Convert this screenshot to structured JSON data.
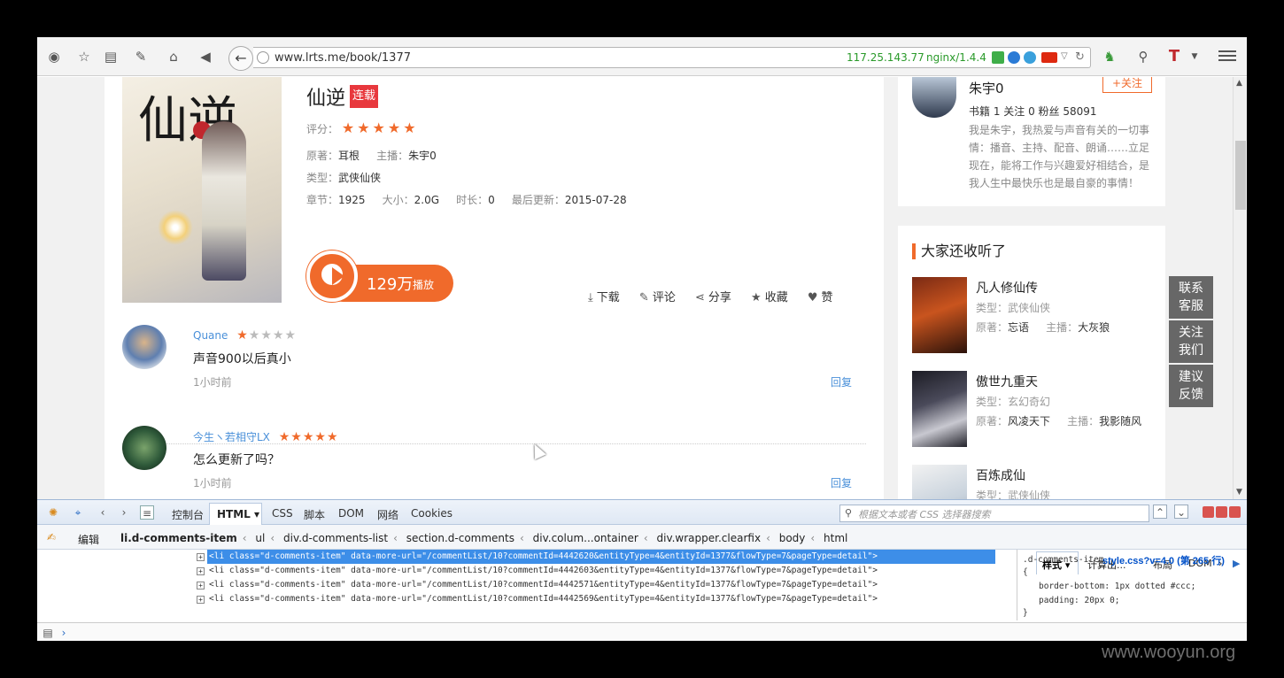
{
  "browser": {
    "url": "www.lrts.me/book/1377",
    "ip": "117.25.143.77",
    "server": "nginx/1.4.4"
  },
  "book": {
    "title": "仙逆",
    "status_badge": "连载",
    "rating_label": "评分：",
    "rating_stars": "★★★★★",
    "author_label": "原著：",
    "author": "耳根",
    "host_label": "主播：",
    "host": "朱宇0",
    "category_label": "类型：",
    "category": "武侠仙侠",
    "chapters_label": "章节：",
    "chapters": "1925",
    "size_label": "大小：",
    "size": "2.0G",
    "duration_label": "时长：",
    "duration": "0",
    "updated_label": "最后更新：",
    "updated": "2015-07-28",
    "play_count": "129万",
    "play_label": "播放",
    "cover_text": "仙逆"
  },
  "actions": {
    "download": "下载",
    "comment": "评论",
    "share": "分享",
    "favorite": "收藏",
    "like": "赞"
  },
  "comments": [
    {
      "user": "Quane",
      "rating": 1,
      "text": "声音900以后真小",
      "time": "1小时前",
      "reply": "回复"
    },
    {
      "user": "今生ヽ若相守LX",
      "rating": 5,
      "text": "怎么更新了吗？",
      "time": "1小时前",
      "reply": "回复"
    }
  ],
  "author_card": {
    "name": "朱宇0",
    "follow": "+关注",
    "stats": "书籍 1  关注 0  粉丝 58091",
    "bio": "我是朱宇，我热爱与声音有关的一切事情：播音、主持、配音、朗诵……立足现在，能将工作与兴趣爱好相结合，是我人生中最快乐也是最自豪的事情！"
  },
  "recommend": {
    "title": "大家还收听了",
    "type_label": "类型：",
    "author_label": "原著：",
    "host_label": "主播：",
    "items": [
      {
        "name": "凡人修仙传",
        "type": "武侠仙侠",
        "author": "忘语",
        "host": "大灰狼"
      },
      {
        "name": "傲世九重天",
        "type": "玄幻奇幻",
        "author": "风凌天下",
        "host": "我影随风"
      },
      {
        "name": "百炼成仙",
        "type": "武侠仙侠"
      }
    ]
  },
  "float_buttons": [
    "联系客服",
    "关注我们",
    "建议反馈"
  ],
  "devtools": {
    "tabs": [
      "控制台",
      "HTML",
      "CSS",
      "脚本",
      "DOM",
      "网络",
      "Cookies"
    ],
    "search_placeholder": "根据文本或者 CSS 选择器搜索",
    "edit": "编辑",
    "breadcrumb": [
      "li.d-comments-item",
      "ul",
      "div.d-comments-list",
      "section.d-comments",
      "div.colum...ontainer",
      "div.wrapper.clearfix",
      "body",
      "html"
    ],
    "side_tabs": [
      "样式",
      "计算出...",
      "布局",
      "DOM"
    ],
    "source_lines": [
      "<li class=\"d-comments-item\" data-more-url=\"/commentList/10?commentId=4442620&entityType=4&entityId=1377&flowType=7&pageType=detail\">",
      "<li class=\"d-comments-item\" data-more-url=\"/commentList/10?commentId=4442603&entityType=4&entityId=1377&flowType=7&pageType=detail\">",
      "<li class=\"d-comments-item\" data-more-url=\"/commentList/10?commentId=4442571&entityType=4&entityId=1377&flowType=7&pageType=detail\">",
      "<li class=\"d-comments-item\" data-more-url=\"/commentList/10?commentId=4442569&entityType=4&entityId=1377&flowType=7&pageType=detail\">"
    ],
    "css_selector": ".d-comments-item",
    "css_source": "style.css?v=4.0 (第 265 行)",
    "css_open": "{",
    "css_props": [
      "border-bottom: 1px dotted #ccc;",
      "padding: 20px 0;"
    ],
    "css_close": "}"
  },
  "watermark": "www.wooyun.org"
}
